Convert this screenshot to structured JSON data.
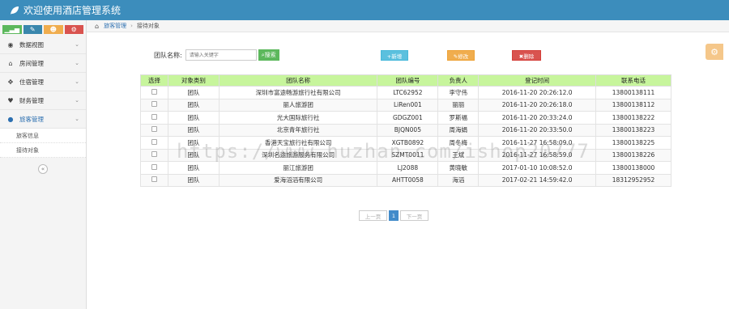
{
  "app": {
    "title": "欢迎使用酒店管理系统"
  },
  "quick_buttons": [
    {
      "icon": "signal-icon",
      "glyph": "▁▃▅",
      "color": "#5cb85c"
    },
    {
      "icon": "pencil-icon",
      "glyph": "✎",
      "color": "#3a87ad"
    },
    {
      "icon": "users-icon",
      "glyph": "☻",
      "color": "#f0ad4e"
    },
    {
      "icon": "cogs-icon",
      "glyph": "⚙",
      "color": "#d9534f"
    }
  ],
  "sidebar": {
    "items": [
      {
        "label": "数据视图",
        "icon": "dashboard-icon",
        "glyph": "◉"
      },
      {
        "label": "房间管理",
        "icon": "home-icon",
        "glyph": "⌂"
      },
      {
        "label": "住宿管理",
        "icon": "move-icon",
        "glyph": "✥"
      },
      {
        "label": "财务管理",
        "icon": "heart-icon",
        "glyph": "♥"
      },
      {
        "label": "旅客管理",
        "icon": "user-icon",
        "glyph": "👤"
      }
    ],
    "subitems": [
      "旅客信息",
      "接待对象"
    ]
  },
  "breadcrumb": {
    "crumb1": "旅客管理",
    "crumb2": "接待对象"
  },
  "toolbar": {
    "search_label": "团队名称:",
    "search_placeholder": "请输入关键字",
    "search_button": "搜索",
    "add_button": "+新增",
    "edit_button": "✎修改",
    "delete_button": "✖删除"
  },
  "table": {
    "headers": [
      "选择",
      "对象类别",
      "团队名称",
      "团队编号",
      "负责人",
      "登记时间",
      "联系电话"
    ],
    "rows": [
      [
        "团队",
        "深圳市富途畅游旅行社有限公司",
        "LTC62952",
        "李守伟",
        "2016-11-20 20:26:12.0",
        "13800138111"
      ],
      [
        "团队",
        "丽人旅游团",
        "LiRen001",
        "丽丽",
        "2016-11-20 20:26:18.0",
        "13800138112"
      ],
      [
        "团队",
        "光大国际旅行社",
        "GDGZ001",
        "罗斯福",
        "2016-11-20 20:33:24.0",
        "13800138222"
      ],
      [
        "团队",
        "北京青年旅行社",
        "BJQN005",
        "周海娟",
        "2016-11-20 20:33:50.0",
        "13800138223"
      ],
      [
        "团队",
        "香港天宝旅行社有限公司",
        "XGTB0892",
        "周冬梅",
        "2016-11-27 16:58:09.0",
        "13800138225"
      ],
      [
        "团队",
        "深圳名途旅游服务有限公司",
        "SZMT0011",
        "王斌",
        "2016-11-27 16:58:59.0",
        "13800138226"
      ],
      [
        "团队",
        "丽江旅游团",
        "LJ2088",
        "黄晓敏",
        "2017-01-10 10:08:52.0",
        "13800138000"
      ],
      [
        "团队",
        "爱海滔滔有限公司",
        "AHTT0058",
        "海滔",
        "2017-02-21 14:59:42.0",
        "18312952952"
      ]
    ]
  },
  "pager": {
    "prev": "上一页",
    "page": "1",
    "next": "下一页"
  },
  "watermark": "https://www.huzhan.com/ishop20777"
}
